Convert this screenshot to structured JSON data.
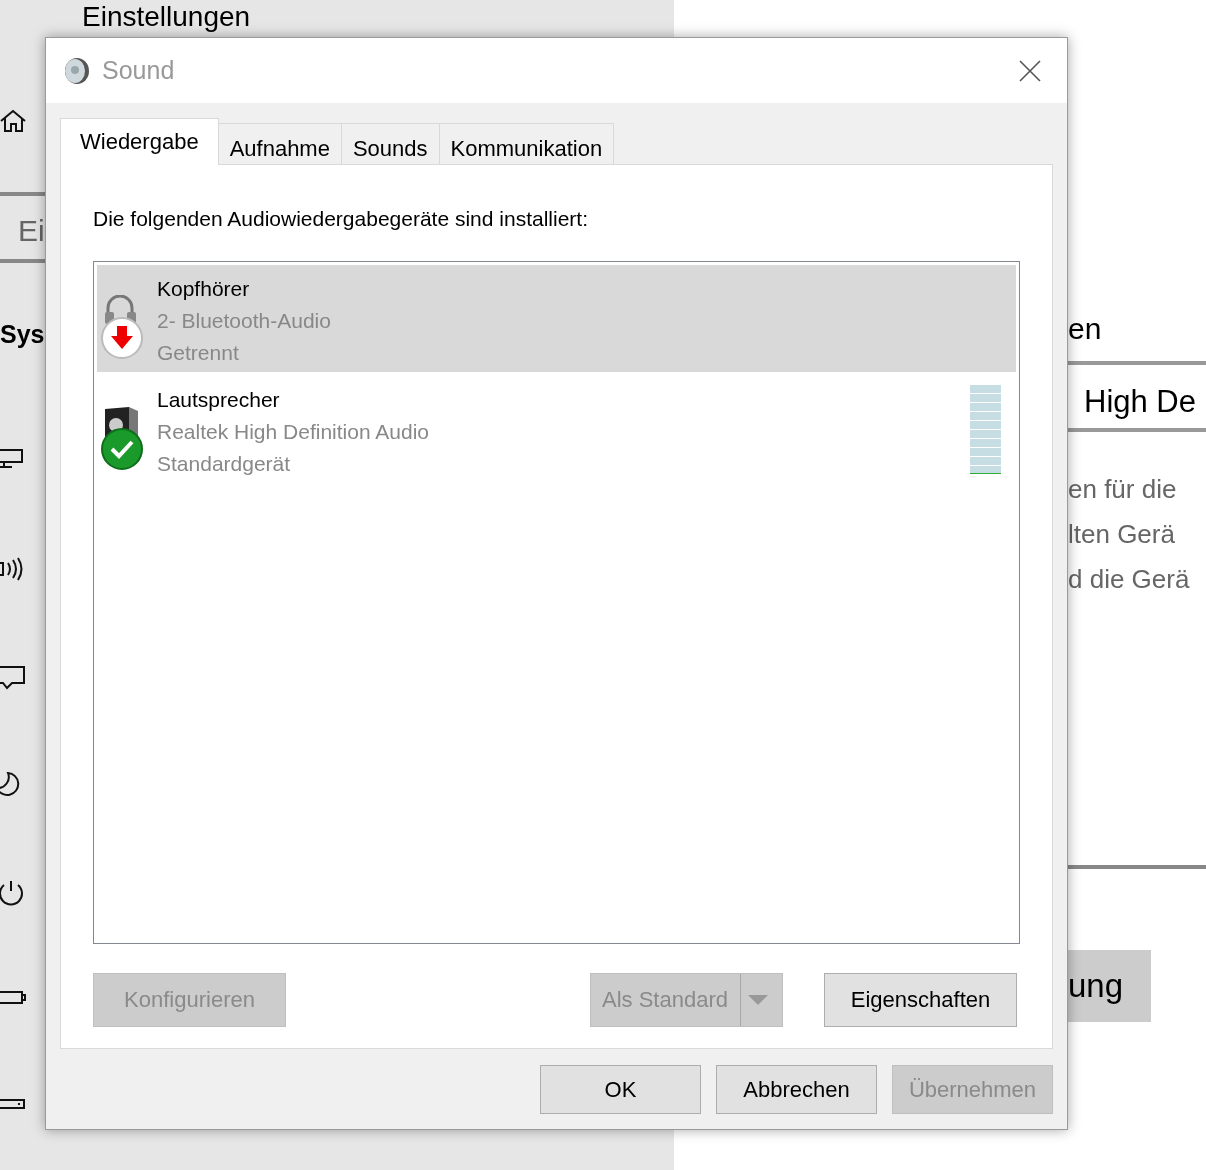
{
  "background": {
    "title": "Einstellungen",
    "search_stub": "Ei",
    "section": "Sys",
    "right_heading": "en",
    "right_field": "High De",
    "right_lines": [
      "en für die",
      "lten Gerä",
      "d die Gerä"
    ],
    "right_button": "ung"
  },
  "window": {
    "title": "Sound"
  },
  "tabs": [
    {
      "label": "Wiedergabe",
      "selected": true
    },
    {
      "label": "Aufnahme",
      "selected": false
    },
    {
      "label": "Sounds",
      "selected": false
    },
    {
      "label": "Kommunikation",
      "selected": false
    }
  ],
  "intro": "Die folgenden Audiowiedergabegeräte sind installiert:",
  "devices": [
    {
      "name": "Kopfhörer",
      "driver": "2- Bluetooth-Audio",
      "status": "Getrennt",
      "kind": "headphones",
      "disconnected": true,
      "default": false,
      "selected": true
    },
    {
      "name": "Lautsprecher",
      "driver": "Realtek High Definition Audio",
      "status": "Standardgerät",
      "kind": "speaker",
      "disconnected": false,
      "default": true,
      "selected": false,
      "level": 0
    }
  ],
  "panel_buttons": [
    {
      "label": "Konfigurieren",
      "kind": "plain",
      "disabled": true
    },
    {
      "label": "Als Standard",
      "kind": "split",
      "disabled": true
    },
    {
      "label": "Eigenschaften",
      "kind": "plain",
      "disabled": false
    }
  ],
  "dialog_buttons": [
    {
      "label": "OK",
      "disabled": false
    },
    {
      "label": "Abbrechen",
      "disabled": false
    },
    {
      "label": "Übernehmen",
      "disabled": true
    }
  ]
}
